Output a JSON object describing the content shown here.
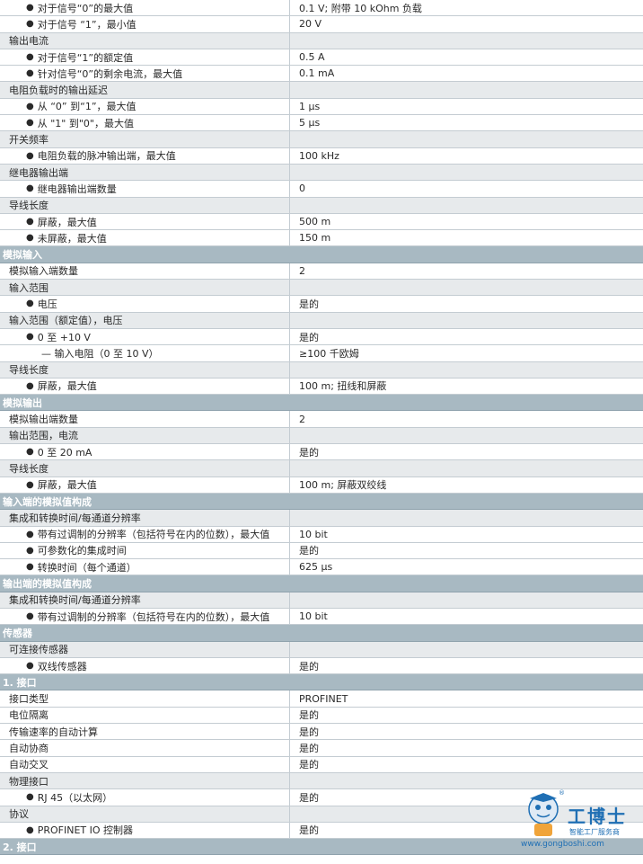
{
  "rows": [
    {
      "kind": "item",
      "level": 2,
      "label": "对于信号“0”的最大值",
      "value": "0.1 V; 附带 10 kOhm 负载"
    },
    {
      "kind": "item",
      "level": 2,
      "label": "对于信号 “1”，最小值",
      "value": "20 V"
    },
    {
      "kind": "group",
      "label": "输出电流"
    },
    {
      "kind": "item",
      "level": 2,
      "label": "对于信号“1”的额定值",
      "value": "0.5 A"
    },
    {
      "kind": "item",
      "level": 2,
      "label": "针对信号“0”的剩余电流，最大值",
      "value": "0.1 mA"
    },
    {
      "kind": "group",
      "label": "电阻负载时的输出延迟"
    },
    {
      "kind": "item",
      "level": 2,
      "label": "从 “0” 到“1”，最大值",
      "value": "1 μs"
    },
    {
      "kind": "item",
      "level": 2,
      "label": "从 \"1\" 到\"0\"，最大值",
      "value": "5 μs"
    },
    {
      "kind": "group",
      "label": "开关频率"
    },
    {
      "kind": "item",
      "level": 2,
      "label": "电阻负载的脉冲输出端，最大值",
      "value": "100 kHz"
    },
    {
      "kind": "group",
      "label": "继电器输出端"
    },
    {
      "kind": "item",
      "level": 2,
      "label": "继电器输出端数量",
      "value": "0"
    },
    {
      "kind": "group",
      "label": "导线长度"
    },
    {
      "kind": "item",
      "level": 2,
      "label": "屏蔽，最大值",
      "value": "500 m"
    },
    {
      "kind": "item",
      "level": 2,
      "label": "未屏蔽，最大值",
      "value": "150 m"
    },
    {
      "kind": "section",
      "label": "模拟输入"
    },
    {
      "kind": "item",
      "level": 1,
      "label": "模拟输入端数量",
      "value": "2"
    },
    {
      "kind": "group",
      "label": "输入范围"
    },
    {
      "kind": "item",
      "level": 2,
      "label": "电压",
      "value": "是的"
    },
    {
      "kind": "group",
      "label": "输入范围（额定值），电压"
    },
    {
      "kind": "item",
      "level": 2,
      "label": "0 至 +10 V",
      "value": "是的"
    },
    {
      "kind": "item",
      "level": 3,
      "label": "— 输入电阻（0 至 10 V）",
      "value": "≥100 千欧姆"
    },
    {
      "kind": "group",
      "label": "导线长度"
    },
    {
      "kind": "item",
      "level": 2,
      "label": "屏蔽，最大值",
      "value": "100 m; 扭线和屏蔽"
    },
    {
      "kind": "section",
      "label": "模拟输出"
    },
    {
      "kind": "item",
      "level": 1,
      "label": "模拟输出端数量",
      "value": "2"
    },
    {
      "kind": "group",
      "label": "输出范围，电流"
    },
    {
      "kind": "item",
      "level": 2,
      "label": "0 至 20 mA",
      "value": "是的"
    },
    {
      "kind": "group",
      "label": "导线长度"
    },
    {
      "kind": "item",
      "level": 2,
      "label": "屏蔽，最大值",
      "value": "100 m; 屏蔽双绞线"
    },
    {
      "kind": "section",
      "label": "输入端的模拟值构成"
    },
    {
      "kind": "group",
      "label": "集成和转换时间/每通道分辨率"
    },
    {
      "kind": "item",
      "level": 2,
      "label": "带有过调制的分辨率（包括符号在内的位数），最大值",
      "value": "10 bit"
    },
    {
      "kind": "item",
      "level": 2,
      "label": "可参数化的集成时间",
      "value": "是的"
    },
    {
      "kind": "item",
      "level": 2,
      "label": "转换时间（每个通道）",
      "value": "625 μs"
    },
    {
      "kind": "section",
      "label": "输出端的模拟值构成"
    },
    {
      "kind": "group",
      "label": "集成和转换时间/每通道分辨率"
    },
    {
      "kind": "item",
      "level": 2,
      "label": "带有过调制的分辨率（包括符号在内的位数），最大值",
      "value": "10 bit"
    },
    {
      "kind": "section",
      "label": "传感器"
    },
    {
      "kind": "group",
      "label": "可连接传感器"
    },
    {
      "kind": "item",
      "level": 2,
      "label": "双线传感器",
      "value": "是的"
    },
    {
      "kind": "section",
      "label": "1. 接口"
    },
    {
      "kind": "item",
      "level": 1,
      "label": "接口类型",
      "value": "PROFINET"
    },
    {
      "kind": "item",
      "level": 1,
      "label": "电位隔离",
      "value": "是的"
    },
    {
      "kind": "item",
      "level": 1,
      "label": "传输速率的自动计算",
      "value": "是的"
    },
    {
      "kind": "item",
      "level": 1,
      "label": "自动协商",
      "value": "是的"
    },
    {
      "kind": "item",
      "level": 1,
      "label": "自动交叉",
      "value": "是的"
    },
    {
      "kind": "group",
      "label": "物理接口"
    },
    {
      "kind": "item",
      "level": 2,
      "label": "RJ 45（以太网）",
      "value": "是的"
    },
    {
      "kind": "group",
      "label": "协议"
    },
    {
      "kind": "item",
      "level": 2,
      "label": "PROFINET IO 控制器",
      "value": "是的"
    },
    {
      "kind": "section",
      "label": "2. 接口"
    }
  ],
  "watermark": {
    "brand": "工博士",
    "tagline": "智能工厂服务商",
    "url": "www.gongboshi.com",
    "registered_mark": "®",
    "colors": {
      "brand": "#1f6fb4"
    },
    "icon": "robot-mascot-icon"
  },
  "colors": {
    "section_bg": "#a8b9c2",
    "group_bg": "#e7eaec",
    "divider": "#c4ccd2"
  }
}
